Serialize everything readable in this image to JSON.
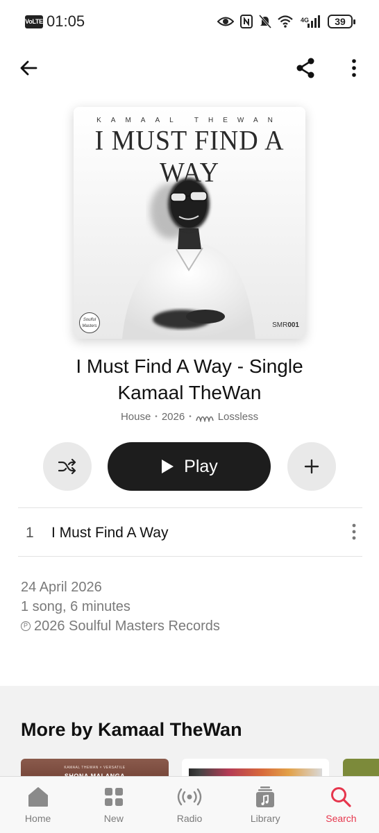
{
  "status_bar": {
    "volte": "VoLTE",
    "time": "01:05",
    "network": "4G",
    "battery": "39"
  },
  "album": {
    "artwork": {
      "artist_text": "KAMAAL THEWAN",
      "title_text": "I MUST FIND A WAY",
      "label_logo_text": "Soulful Masters",
      "catalog_prefix": "SMR",
      "catalog_number": "001"
    },
    "title": "I Must Find A Way - Single",
    "artist": "Kamaal TheWan",
    "genre": "House",
    "year": "2026",
    "quality": "Lossless"
  },
  "actions": {
    "play_label": "Play"
  },
  "tracks": [
    {
      "number": "1",
      "title": "I Must Find A Way"
    }
  ],
  "release_info": {
    "date": "24 April 2026",
    "summary": "1 song, 6 minutes",
    "copyright": "2026 Soulful Masters Records"
  },
  "more_by": {
    "title": "More by Kamaal TheWan",
    "cards": [
      {
        "caption_top": "KAMAAL THEWAN × VERSATILE",
        "caption_title": "SHONA MALANGA"
      }
    ]
  },
  "tab_bar": {
    "items": [
      {
        "label": "Home",
        "icon": "home-icon"
      },
      {
        "label": "New",
        "icon": "grid-icon"
      },
      {
        "label": "Radio",
        "icon": "radio-icon"
      },
      {
        "label": "Library",
        "icon": "library-icon"
      },
      {
        "label": "Search",
        "icon": "search-icon"
      }
    ],
    "active": "Search",
    "active_color": "#e6364d"
  },
  "colors": {
    "accent": "#e6364d",
    "play_button": "#1d1d1d",
    "secondary_button": "#e9e9e9"
  }
}
